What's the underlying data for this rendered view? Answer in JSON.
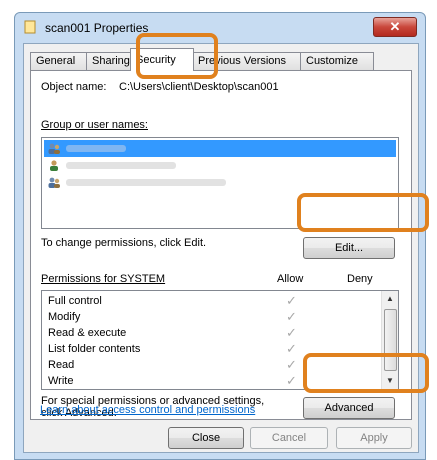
{
  "window": {
    "title": "scan001 Properties",
    "close_glyph": "✕"
  },
  "tabs": [
    "General",
    "Sharing",
    "Security",
    "Previous Versions",
    "Customize"
  ],
  "active_tab": "Security",
  "object": {
    "label": "Object name:",
    "value": "C:\\Users\\client\\Desktop\\scan001"
  },
  "groups": {
    "label": "Group or user names:",
    "icons": [
      "users-icon",
      "user-icon",
      "users-icon"
    ]
  },
  "edit": {
    "prompt": "To change permissions, click Edit.",
    "button": "Edit..."
  },
  "permissions": {
    "label": "Permissions for SYSTEM",
    "allow_header": "Allow",
    "deny_header": "Deny",
    "items": [
      "Full control",
      "Modify",
      "Read & execute",
      "List folder contents",
      "Read",
      "Write"
    ],
    "check_glyph": "✓"
  },
  "special": {
    "text_line1": "For special permissions or advanced settings,",
    "text_line2": "click Advanced.",
    "button": "Advanced"
  },
  "link": "Learn about access control and permissions",
  "footer": {
    "close": "Close",
    "cancel": "Cancel",
    "apply": "Apply"
  },
  "colors": {
    "highlight": "#e0811e",
    "selection": "#3399ff",
    "link": "#0066cc"
  }
}
